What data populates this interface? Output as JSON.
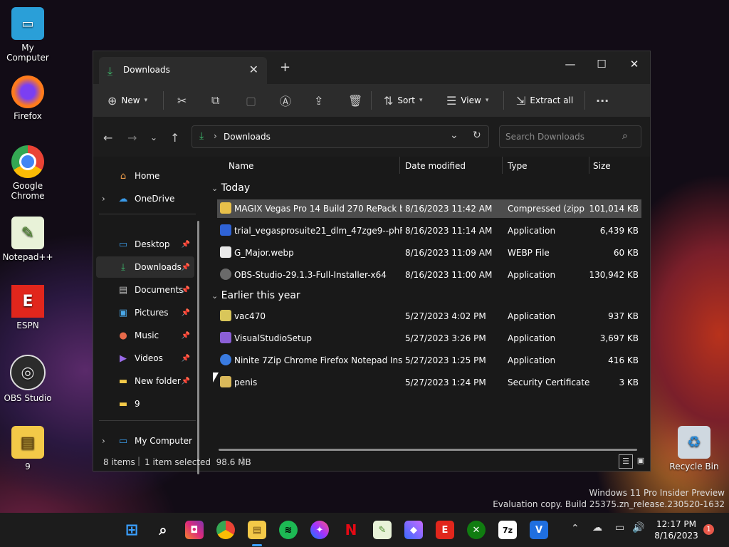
{
  "desktop": {
    "icons": [
      {
        "label": "My Computer",
        "color": "#2a9fd8",
        "glyph": "▭"
      },
      {
        "label": "Firefox",
        "color": "#ff7b1c",
        "glyph": "●"
      },
      {
        "label": "Google Chrome",
        "color": "#ffffff",
        "glyph": "◉"
      },
      {
        "label": "Notepad++",
        "color": "#b5e27a",
        "glyph": "✎"
      },
      {
        "label": "ESPN",
        "color": "#ffffff",
        "glyph": "E"
      },
      {
        "label": "OBS Studio",
        "color": "#2b2b2b",
        "glyph": "◎"
      },
      {
        "label": "9",
        "color": "#f3c948",
        "glyph": "▤"
      }
    ],
    "recycle_bin": "Recycle Bin"
  },
  "window": {
    "tab_title": "Downloads",
    "toolbar": {
      "new_label": "New",
      "sort_label": "Sort",
      "view_label": "View",
      "extract_label": "Extract all"
    },
    "address": {
      "path": "Downloads",
      "search_placeholder": "Search Downloads"
    },
    "sidebar": {
      "home": "Home",
      "onedrive": "OneDrive",
      "quick": [
        "Desktop",
        "Downloads",
        "Documents",
        "Pictures",
        "Music",
        "Videos",
        "New folder",
        "9"
      ],
      "mycomputer": "My Computer"
    },
    "columns": {
      "name": "Name",
      "date": "Date modified",
      "type": "Type",
      "size": "Size"
    },
    "groups": {
      "today": "Today",
      "earlier": "Earlier this year"
    },
    "files_today": [
      {
        "name": "MAGIX Vegas Pro 14 Build 270 RePack by ...",
        "date": "8/16/2023 11:42 AM",
        "type": "Compressed (zipp...",
        "size": "101,014 KB",
        "color": "#e8c04a"
      },
      {
        "name": "trial_vegasprosuite21_dlm_47zge9--phFp...",
        "date": "8/16/2023 11:14 AM",
        "type": "Application",
        "size": "6,439 KB",
        "color": "#2f63d6"
      },
      {
        "name": "G_Major.webp",
        "date": "8/16/2023 11:09 AM",
        "type": "WEBP File",
        "size": "60 KB",
        "color": "#e8e8e8"
      },
      {
        "name": "OBS-Studio-29.1.3-Full-Installer-x64",
        "date": "8/16/2023 11:00 AM",
        "type": "Application",
        "size": "130,942 KB",
        "color": "#6a6a6a"
      }
    ],
    "files_earlier": [
      {
        "name": "vac470",
        "date": "5/27/2023 4:02 PM",
        "type": "Application",
        "size": "937 KB",
        "color": "#d9c65a"
      },
      {
        "name": "VisualStudioSetup",
        "date": "5/27/2023 3:26 PM",
        "type": "Application",
        "size": "3,697 KB",
        "color": "#8b5fd6"
      },
      {
        "name": "Ninite 7Zip Chrome Firefox Notepad Inst...",
        "date": "5/27/2023 1:25 PM",
        "type": "Application",
        "size": "416 KB",
        "color": "#3a7be0"
      },
      {
        "name": "penis",
        "date": "5/27/2023 1:24 PM",
        "type": "Security Certificate",
        "size": "3 KB",
        "color": "#d9b85a"
      }
    ],
    "status": {
      "count": "8 items",
      "selected": "1 item selected  98.6 MB"
    }
  },
  "watermark": {
    "line1": "Windows 11 Pro Insider Preview",
    "line2": "Evaluation copy. Build 25375.zn_release.230520-1632"
  },
  "taskbar": {
    "apps": [
      {
        "name": "start",
        "color": "#3aa0ff",
        "glyph": "⊞"
      },
      {
        "name": "search",
        "color": "#ffffff",
        "glyph": "⌕"
      },
      {
        "name": "instagram",
        "color": "#e1306c",
        "glyph": "◘"
      },
      {
        "name": "chrome",
        "color": "#34a853",
        "glyph": "◉"
      },
      {
        "name": "file-explorer",
        "color": "#f3c948",
        "glyph": "▤"
      },
      {
        "name": "spotify",
        "color": "#1db954",
        "glyph": "≋"
      },
      {
        "name": "messenger",
        "color": "#7a5cff",
        "glyph": "✦"
      },
      {
        "name": "netflix",
        "color": "#e50914",
        "glyph": "N"
      },
      {
        "name": "notepadpp",
        "color": "#9bd26b",
        "glyph": "✎"
      },
      {
        "name": "copilot",
        "color": "#6a8cff",
        "glyph": "◆"
      },
      {
        "name": "espn",
        "color": "#e1261c",
        "glyph": "E"
      },
      {
        "name": "xbox",
        "color": "#107c10",
        "glyph": "✕"
      },
      {
        "name": "7zip",
        "color": "#ffffff",
        "glyph": "7z"
      },
      {
        "name": "vegas",
        "color": "#1f6fe0",
        "glyph": "V"
      }
    ],
    "time": "12:17 PM",
    "date": "8/16/2023",
    "notif": "1"
  }
}
